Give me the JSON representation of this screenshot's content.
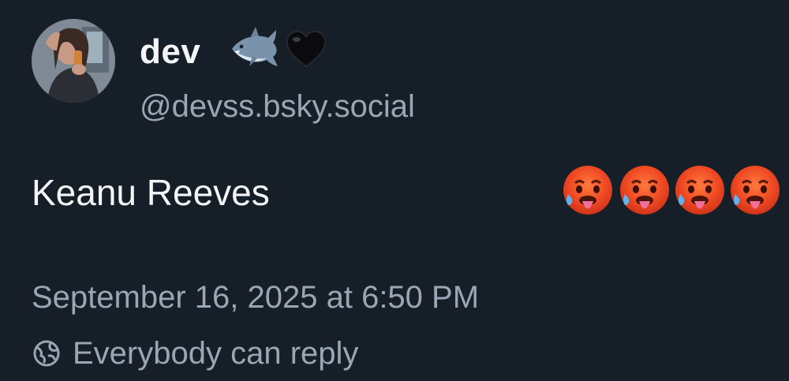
{
  "author": {
    "display_name": "dev",
    "name_emojis": [
      "shark-emoji",
      "black-heart-emoji"
    ],
    "handle": "@devss.bsky.social",
    "avatar_icon": "user-avatar"
  },
  "post": {
    "text": "Keanu Reeves",
    "emojis": [
      "hot-face-emoji",
      "hot-face-emoji",
      "hot-face-emoji",
      "hot-face-emoji"
    ],
    "timestamp": "September 16, 2025 at 6:50 PM"
  },
  "reply_settings": {
    "icon": "globe-icon",
    "label": "Everybody can reply"
  },
  "colors": {
    "background": "#161e28",
    "primary_text": "#f3f5f7",
    "secondary_text": "#9aa6b4"
  }
}
